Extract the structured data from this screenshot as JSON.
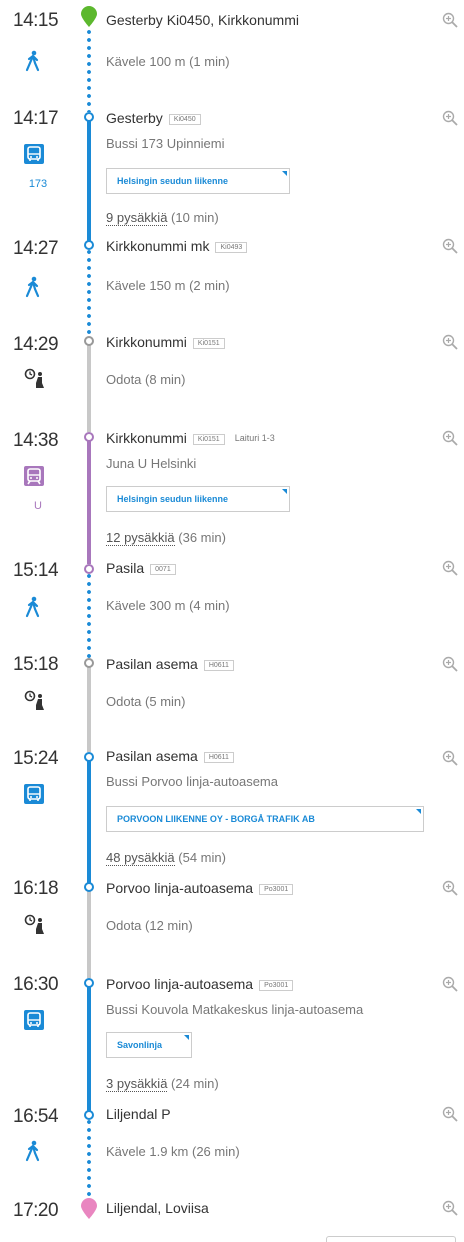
{
  "colors": {
    "bus": "#1a8ad6",
    "train": "#a877bc",
    "wait": "#c8c8c8",
    "walk": "#1a8ad6",
    "start": "#5cb82e",
    "end": "#e986c0"
  },
  "legs": [
    {
      "time": "14:15",
      "name": "Gesterby Ki0450, Kirkkonummi",
      "code": "",
      "platform": "",
      "desc": "Kävele 100 m (1 min)",
      "mode": "walk-icon"
    },
    {
      "time": "14:17",
      "name": "Gesterby",
      "code": "Ki0450",
      "platform": "",
      "desc": "Bussi 173 Upinniemi",
      "mode": "bus-icon",
      "route": "173",
      "agency": "Helsingin seudun liikenne",
      "stops_count": "9 pysäkkiä",
      "stops_dur": "(10 min)"
    },
    {
      "time": "14:27",
      "name": "Kirkkonummi mk",
      "code": "Ki0493",
      "platform": "",
      "desc": "Kävele 150 m (2 min)",
      "mode": "walk-icon"
    },
    {
      "time": "14:29",
      "name": "Kirkkonummi",
      "code": "Ki0151",
      "platform": "",
      "desc": "Odota (8 min)",
      "mode": "wait-icon"
    },
    {
      "time": "14:38",
      "name": "Kirkkonummi",
      "code": "Ki0151",
      "platform": "Laituri 1-3",
      "desc": "Juna U Helsinki",
      "mode": "train-icon",
      "route": "U",
      "agency": "Helsingin seudun liikenne",
      "stops_count": "12 pysäkkiä",
      "stops_dur": "(36 min)"
    },
    {
      "time": "15:14",
      "name": "Pasila",
      "code": "0071",
      "platform": "",
      "desc": "Kävele 300 m (4 min)",
      "mode": "walk-icon"
    },
    {
      "time": "15:18",
      "name": "Pasilan asema",
      "code": "H0611",
      "platform": "",
      "desc": "Odota (5 min)",
      "mode": "wait-icon"
    },
    {
      "time": "15:24",
      "name": "Pasilan asema",
      "code": "H0611",
      "platform": "",
      "desc": "Bussi Porvoo linja-autoasema",
      "mode": "bus-icon",
      "route": "",
      "agency": "PORVOON LIIKENNE OY - BORGÅ TRAFIK AB",
      "stops_count": "48 pysäkkiä",
      "stops_dur": "(54 min)"
    },
    {
      "time": "16:18",
      "name": "Porvoo linja-autoasema",
      "code": "Po3001",
      "platform": "",
      "desc": "Odota (12 min)",
      "mode": "wait-icon"
    },
    {
      "time": "16:30",
      "name": "Porvoo linja-autoasema",
      "code": "Po3001",
      "platform": "",
      "desc": "Bussi Kouvola Matkakeskus linja-autoasema",
      "mode": "bus-icon",
      "route": "",
      "agency": "Savonlinja",
      "stops_count": "3 pysäkkiä",
      "stops_dur": "(24 min)"
    },
    {
      "time": "16:54",
      "name": "Liljendal P",
      "code": "",
      "platform": "",
      "desc": "Kävele 1.9 km (26 min)",
      "mode": "walk-icon"
    },
    {
      "time": "17:20",
      "name": "Liljendal, Loviisa",
      "code": "",
      "platform": "",
      "desc": "",
      "mode": ""
    }
  ]
}
